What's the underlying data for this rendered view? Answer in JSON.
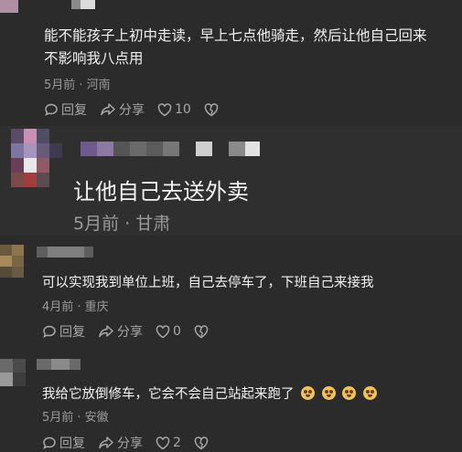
{
  "comments": [
    {
      "text_line1": "能不能孩子上初中走读，早上七点他骑走，然后让他自己回来",
      "text_line2": "不影响我八点用",
      "meta": "5月前 · 河南",
      "reply": "回复",
      "share": "分享",
      "likes": "10"
    },
    {
      "text": "让他自己去送外卖",
      "meta": "5月前 · 甘肃"
    },
    {
      "text": "可以实现我到单位上班，自己去停车了，下班自己来接我",
      "meta": "4月前 · 重庆",
      "reply": "回复",
      "share": "分享",
      "likes": "0"
    },
    {
      "text": "我给它放倒修车，它会不会自己站起来跑了",
      "meta": "5月前 · 安徽",
      "reply": "回复",
      "share": "分享",
      "likes": "2"
    }
  ],
  "icons": {
    "reply": "reply-bubble-icon",
    "share": "share-arrow-icon",
    "like": "heart-icon",
    "dislike": "broken-heart-icon",
    "emoji": "grimacing-face-emoji"
  },
  "colors": {
    "background": "#2b2b2b",
    "text": "#f2f2f2",
    "meta": "#9a9a9a",
    "emoji": "#f0c35a"
  }
}
